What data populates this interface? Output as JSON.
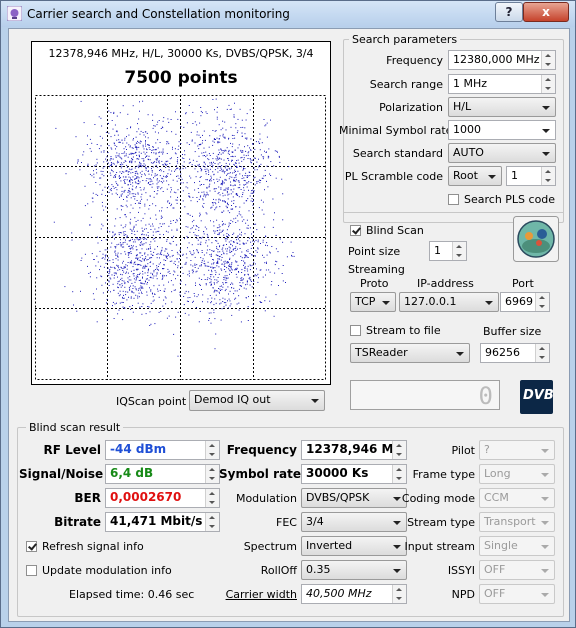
{
  "window": {
    "title": "Carrier search and Constellation monitoring",
    "help_label": "?",
    "close_label": "x"
  },
  "constellation": {
    "info": "12378,946 MHz, H/L, 30000 Ks, DVBS/QPSK, 3/4",
    "points_label": "7500 points",
    "point_color": "#1a1ab8",
    "iqscan_label": "IQScan point",
    "iqscan_value": "Demod IQ out"
  },
  "search": {
    "group_label": "Search parameters",
    "frequency_label": "Frequency",
    "frequency_value": "12380,000 MHz",
    "range_label": "Search range",
    "range_value": "1 MHz",
    "polarization_label": "Polarization",
    "polarization_value": "H/L",
    "min_sr_label": "Minimal Symbol rate",
    "min_sr_value": "1000",
    "standard_label": "Search standard",
    "standard_value": "AUTO",
    "pls_label": "PL Scramble code",
    "pls_mode": "Root",
    "pls_value": "1",
    "search_pls_label": "Search PLS code"
  },
  "blindscan": {
    "label": "Blind Scan",
    "point_size_label": "Point size",
    "point_size_value": "1",
    "streaming_label": "Streaming",
    "proto_label": "Proto",
    "proto_value": "TCP",
    "ip_label": "IP-address",
    "ip_value": "127.0.0.1",
    "port_label": "Port",
    "port_value": "6969",
    "stream_to_file_label": "Stream to file",
    "buffer_label": "Buffer size",
    "buffer_value": "96256",
    "reader_value": "TSReader",
    "digit_display": "0",
    "dvb_logo": "DVB"
  },
  "result": {
    "group_label": "Blind scan result",
    "rf_label": "RF Level",
    "rf_value": "-44 dBm",
    "sn_label": "Signal/Noise",
    "sn_value": "6,4 dB",
    "ber_label": "BER",
    "ber_value": "0,0002670",
    "bitrate_label": "Bitrate",
    "bitrate_value": "41,471 Mbit/s",
    "refresh_label": "Refresh signal info",
    "update_mod_label": "Update modulation info",
    "elapsed": "Elapsed time: 0.46 sec",
    "freq_label": "Frequency",
    "freq_value": "12378,946 MHz",
    "sr_label": "Symbol rate",
    "sr_value": "30000 Ks",
    "mod_label": "Modulation",
    "mod_value": "DVBS/QPSK",
    "fec_label": "FEC",
    "fec_value": "3/4",
    "spectrum_label": "Spectrum",
    "spectrum_value": "Inverted",
    "rolloff_label": "RollOff",
    "rolloff_value": "0.35",
    "cw_label": "Carrier width",
    "cw_value": "40,500 MHz",
    "pilot_label": "Pilot",
    "pilot_value": "?",
    "frame_label": "Frame type",
    "frame_value": "Long",
    "coding_label": "Coding mode",
    "coding_value": "CCM",
    "stream_type_label": "Stream type",
    "stream_type_value": "Transport",
    "input_label": "Input stream",
    "input_value": "Single",
    "issyi_label": "ISSYI",
    "issyi_value": "OFF",
    "npd_label": "NPD",
    "npd_value": "OFF",
    "colors": {
      "rf": "#1f4fd6",
      "sn": "#178a17",
      "ber": "#e01010"
    }
  }
}
